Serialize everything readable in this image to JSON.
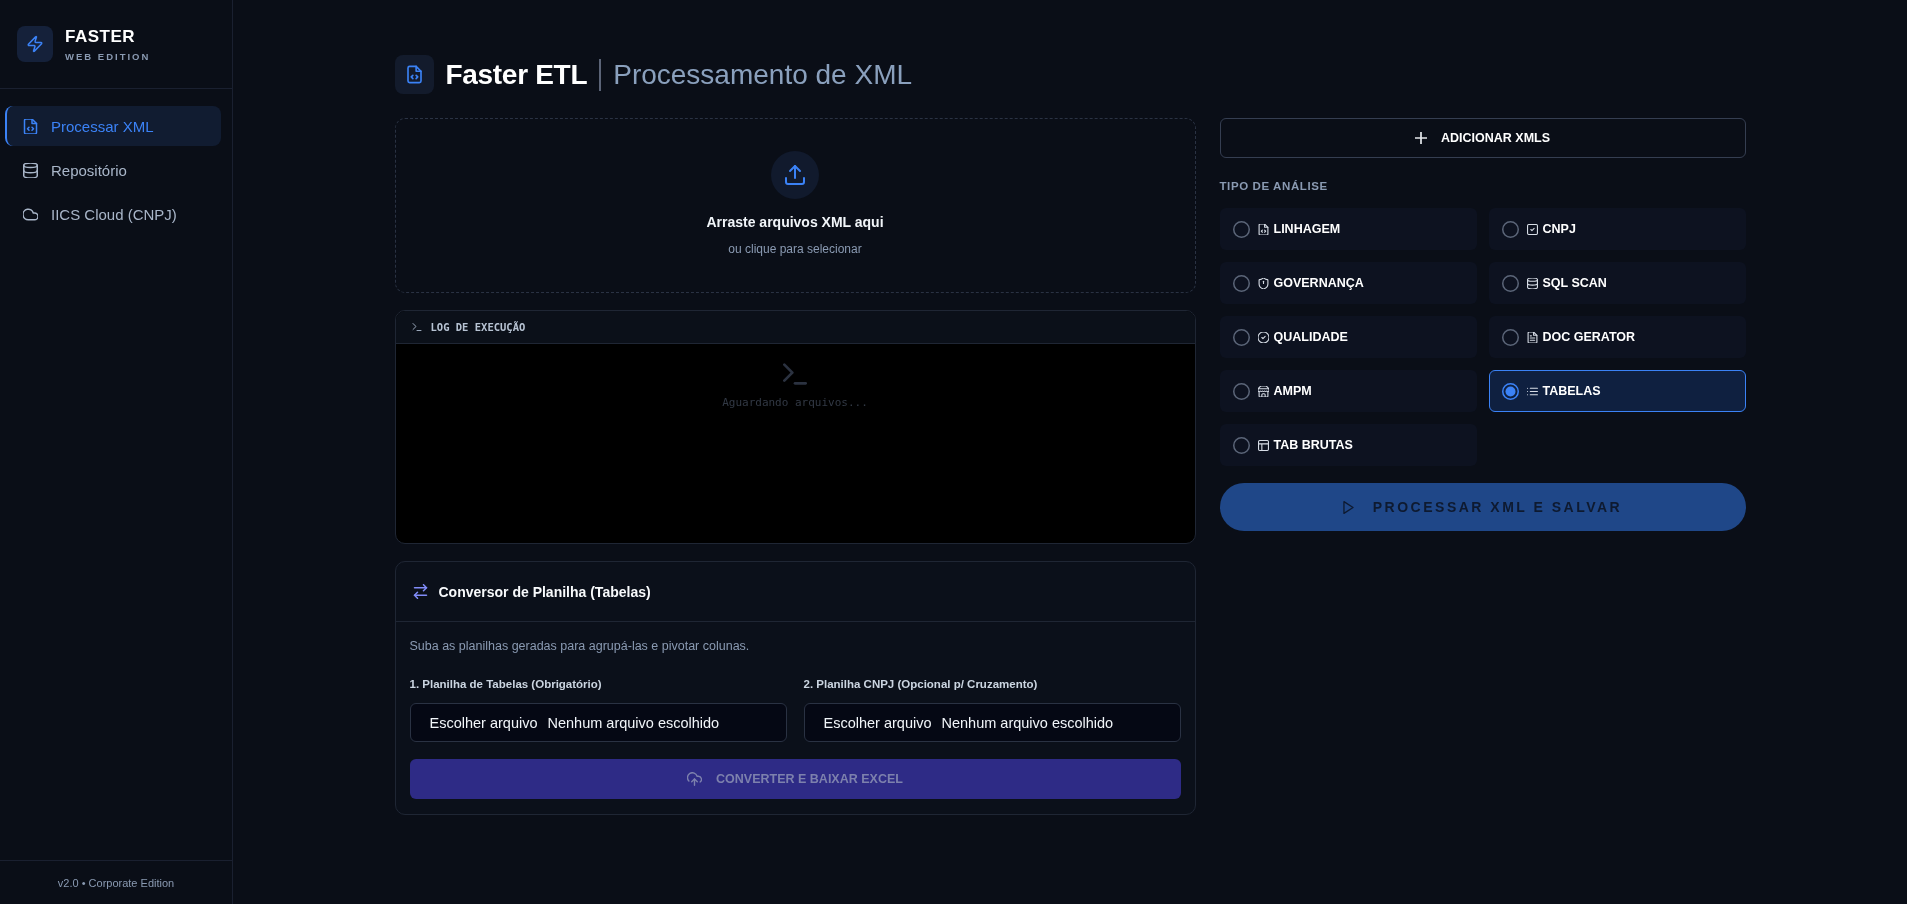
{
  "sidebar": {
    "brand": {
      "title": "FASTER",
      "subtitle": "WEB EDITION"
    },
    "nav_items": [
      {
        "label": "Processar XML",
        "selected": true
      },
      {
        "label": "Repositório",
        "selected": false
      },
      {
        "label": "IICS Cloud (CNPJ)",
        "selected": false
      }
    ],
    "footer": "v2.0 • Corporate Edition"
  },
  "header": {
    "title": "Faster ETL",
    "subtitle": "Processamento de XML"
  },
  "dropzone": {
    "title": "Arraste arquivos XML aqui",
    "hint": "ou clique para selecionar"
  },
  "log": {
    "title": "LOG DE EXECUÇÃO",
    "empty_text": "Aguardando arquivos..."
  },
  "converter": {
    "title": "Conversor de Planilha (Tabelas)",
    "description": "Suba as planilhas geradas para agrupá-las e pivotar colunas.",
    "inputs": [
      {
        "label": "1. Planilha de Tabelas (Obrigatório)",
        "button": "Escolher arquivo",
        "status": "Nenhum arquivo escolhido"
      },
      {
        "label": "2. Planilha CNPJ (Opcional p/ Cruzamento)",
        "button": "Escolher arquivo",
        "status": "Nenhum arquivo escolhido"
      }
    ],
    "button": {
      "label": "CONVERTER E BAIXAR EXCEL",
      "disabled": true
    }
  },
  "actions": {
    "add_button": "ADICIONAR XMLS",
    "analysis_title": "TIPO DE ANÁLISE",
    "analysis_options": [
      {
        "label": "LINHAGEM",
        "selected": false
      },
      {
        "label": "CNPJ",
        "selected": false
      },
      {
        "label": "GOVERNANÇA",
        "selected": false
      },
      {
        "label": "SQL SCAN",
        "selected": false
      },
      {
        "label": "QUALIDADE",
        "selected": false
      },
      {
        "label": "DOC GERATOR",
        "selected": false
      },
      {
        "label": "AMPM",
        "selected": false
      },
      {
        "label": "TABELAS",
        "selected": true
      },
      {
        "label": "TAB BRUTAS",
        "selected": false
      }
    ],
    "process_button": {
      "label": "PROCESSAR XML E SALVAR",
      "disabled": true
    }
  }
}
